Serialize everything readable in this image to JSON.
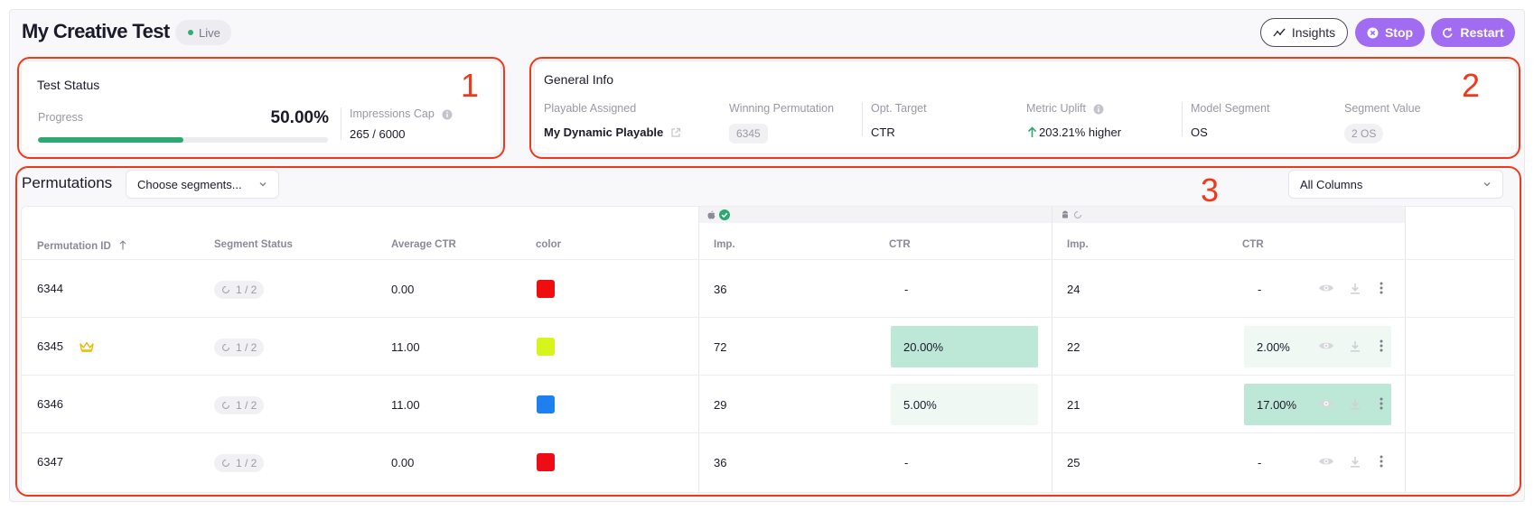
{
  "header": {
    "title": "My Creative Test",
    "status": "Live",
    "insights_label": "Insights",
    "stop_label": "Stop",
    "restart_label": "Restart"
  },
  "test_status": {
    "title": "Test Status",
    "progress_label": "Progress",
    "progress_value": "50.00%",
    "progress_fraction": 0.5,
    "impressions_label": "Impressions Cap",
    "impressions_value": "265 / 6000"
  },
  "general_info": {
    "title": "General Info",
    "playable_label": "Playable Assigned",
    "playable_value": "My Dynamic Playable",
    "winning_label": "Winning Permutation",
    "winning_value": "6345",
    "target_label": "Opt. Target",
    "target_value": "CTR",
    "uplift_label": "Metric Uplift",
    "uplift_value": "203.21% higher",
    "model_label": "Model Segment",
    "model_value": "OS",
    "segment_label": "Segment Value",
    "segment_value": "2 OS"
  },
  "permutations": {
    "title": "Permutations",
    "segments_select": "Choose segments...",
    "columns_select": "All Columns",
    "headers": {
      "id": "Permutation ID",
      "segment_status": "Segment Status",
      "avg_ctr": "Average CTR",
      "color": "color",
      "ios_imp": "Imp.",
      "ios_ctr": "CTR",
      "android_imp": "Imp.",
      "android_ctr": "CTR"
    },
    "rows": [
      {
        "id": "6344",
        "segment": "1 / 2",
        "avg_ctr": "0.00",
        "color": "#f00d0d",
        "ios_imp": "36",
        "ios_ctr": "-",
        "android_imp": "24",
        "android_ctr": "-"
      },
      {
        "id": "6345",
        "segment": "1 / 2",
        "avg_ctr": "11.00",
        "color": "#d8f51b",
        "ios_imp": "72",
        "ios_ctr": "20.00%",
        "android_imp": "22",
        "android_ctr": "2.00%"
      },
      {
        "id": "6346",
        "segment": "1 / 2",
        "avg_ctr": "11.00",
        "color": "#1e7ff0",
        "ios_imp": "29",
        "ios_ctr": "5.00%",
        "android_imp": "21",
        "android_ctr": "17.00%"
      },
      {
        "id": "6347",
        "segment": "1 / 2",
        "avg_ctr": "0.00",
        "color": "#ee0d16",
        "ios_imp": "36",
        "ios_ctr": "-",
        "android_imp": "25",
        "android_ctr": "-"
      }
    ]
  },
  "annotations": [
    "1",
    "2",
    "3"
  ],
  "colors": {
    "accent": "#a26cf2",
    "progress": "#2ea871",
    "ctr_high": "#bde7d6",
    "ctr_low": "#eef8f3",
    "annotation": "#f0391b"
  }
}
